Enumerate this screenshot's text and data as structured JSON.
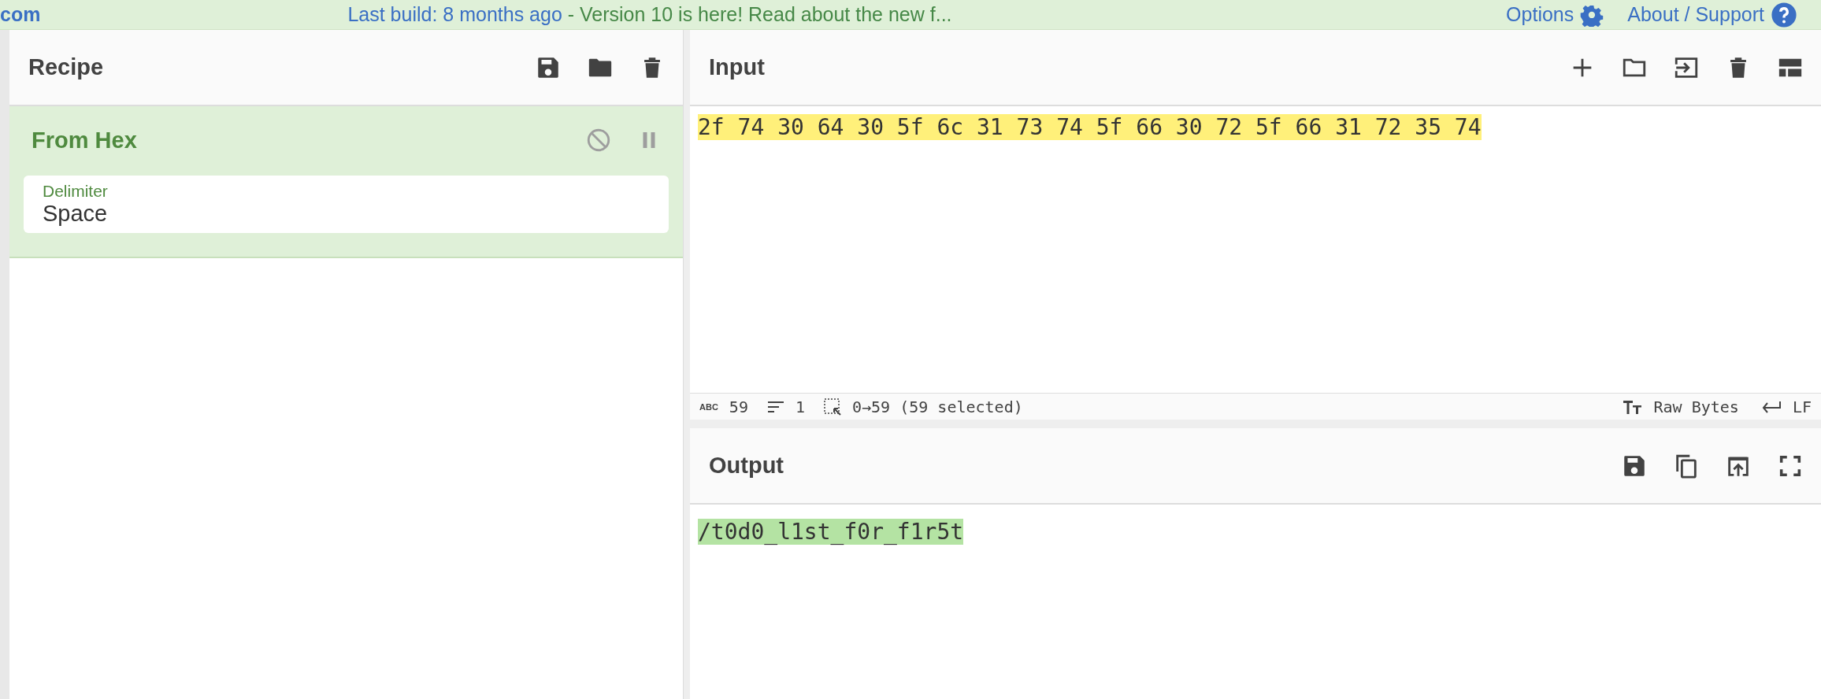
{
  "top_bar": {
    "logo_fragment": "com",
    "build_link": "Last build: 8 months ago",
    "notice": " - Version 10 is here! Read about the new f...",
    "options": "Options",
    "about": "About / Support"
  },
  "recipe": {
    "title": "Recipe",
    "operations": [
      {
        "name": "From Hex",
        "args": [
          {
            "label": "Delimiter",
            "value": "Space"
          }
        ]
      }
    ]
  },
  "input": {
    "title": "Input",
    "text": "2f 74 30 64 30 5f 6c 31 73 74 5f 66 30 72 5f 66 31 72 35 74",
    "selected": true
  },
  "status_bar": {
    "abc": "ABC",
    "length": "59",
    "lines": "1",
    "selection": "0→59 (59 selected)",
    "encoding": "Raw Bytes",
    "eol": "LF"
  },
  "output": {
    "title": "Output",
    "text": "/t0d0_l1st_f0r_f1r5t",
    "highlighted": true
  }
}
